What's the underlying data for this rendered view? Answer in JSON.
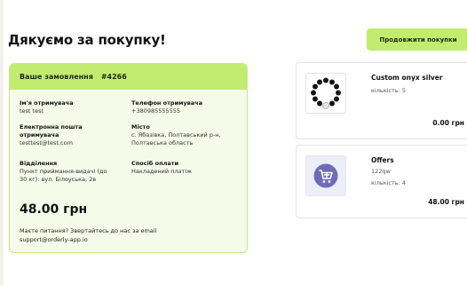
{
  "title": "Дякуємо за покупку!",
  "continue_label": "Продовжити покупки",
  "order": {
    "heading": "Ваше замовлення",
    "number": "#4266",
    "name_label": "Ім'я отримувача",
    "name_value": "test test",
    "phone_label": "Телефон отримувача",
    "phone_value": "+380985555555",
    "email_label_1": "Електронна пошта",
    "email_label_2": "отримувача",
    "email_value": "testtest@test.com",
    "place_label": "Місто",
    "place_value_1": "с. Ябазівка, Полтавський р-н,",
    "place_value_2": "Полтавська область",
    "branch_label": "Відділення",
    "branch_value_1": "Пункт приймання-видачі (до",
    "branch_value_2": "30 кг): вул. Білоуська, 2в",
    "payment_label": "Спосіб оплати",
    "payment_value": "Накладений платіж",
    "total": "48.00 грн",
    "help_1": "Маєте питання? Звертайтесь до нас за email",
    "help_2": "support@orderly-app.io"
  },
  "items": [
    {
      "name": "Custom onyx silver",
      "qty": "кількість: 5",
      "price": "0.00 грн",
      "icon": "bracelet-icon"
    },
    {
      "name": "Offers",
      "sub": "122qw",
      "qty": "кількість: 4",
      "price": "48.00 грн",
      "icon": "add-to-cart-icon"
    }
  ],
  "colors": {
    "accent": "#c1ec6f",
    "card_bg": "#f6fae8",
    "offer_icon": "#6e6bbd"
  }
}
